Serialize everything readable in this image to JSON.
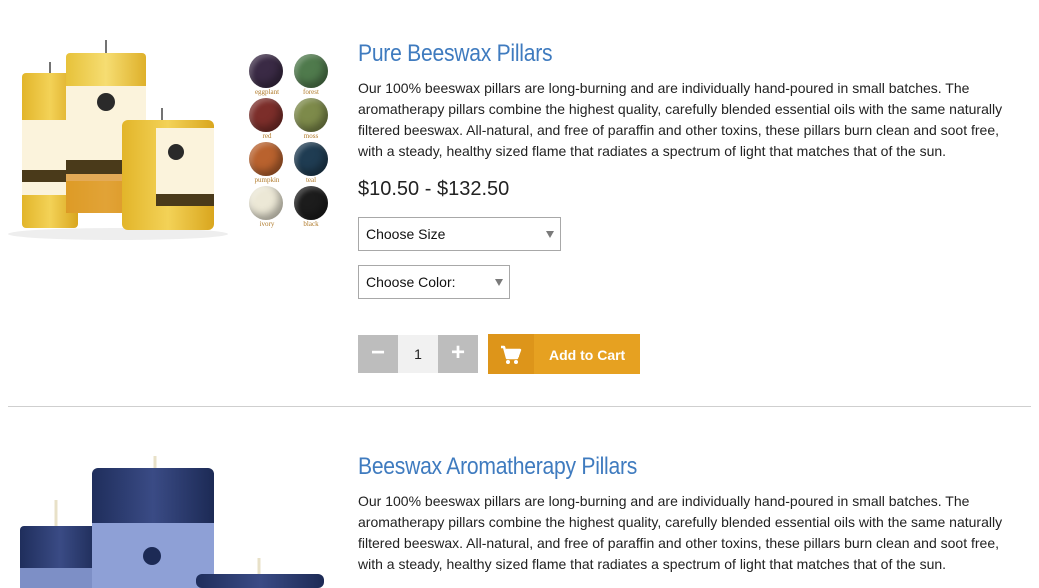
{
  "products": [
    {
      "title": "Pure Beeswax Pillars",
      "description": "Our 100% beeswax pillars are long-burning and are individually hand-poured in small batches. The aromatherapy pillars combine the highest quality, carefully blended essential oils with the same naturally filtered beeswax. All-natural, and free of paraffin and other toxins, these pillars burn clean and soot free, with a steady, healthy sized flame that radiates a spectrum of light that matches that of the sun.",
      "price": "$10.50 - $132.50",
      "size_select": "Choose Size",
      "color_select": "Choose Color:",
      "qty_minus": "−",
      "qty_value": "1",
      "qty_plus": "+",
      "add_to_cart": "Add to Cart",
      "swatches": [
        {
          "label": "eggplant",
          "color": "#3a2a45"
        },
        {
          "label": "forest",
          "color": "#4f7a4c"
        },
        {
          "label": "red",
          "color": "#7c2e2a"
        },
        {
          "label": "moss",
          "color": "#7d8a4a"
        },
        {
          "label": "pumpkin",
          "color": "#b9622e"
        },
        {
          "label": "teal",
          "color": "#1f3c52"
        },
        {
          "label": "ivory",
          "color": "#ece8d6"
        },
        {
          "label": "black",
          "color": "#1c1c1c"
        }
      ]
    },
    {
      "title": "Beeswax Aromatherapy Pillars",
      "description": "Our 100% beeswax pillars are long-burning and are individually hand-poured in small batches. The aromatherapy pillars combine the highest quality, carefully blended essential oils with the same naturally filtered beeswax. All-natural, and free of paraffin and other toxins, these pillars burn clean and soot free, with a steady, healthy sized flame that radiates a spectrum of light that matches that of the sun."
    }
  ],
  "colors": {
    "title": "#3f7bbf",
    "cart_button": "#e6a121",
    "qty_button": "#bdbdbd"
  },
  "icons": [
    "cart-icon",
    "dropdown-arrow-icon"
  ]
}
